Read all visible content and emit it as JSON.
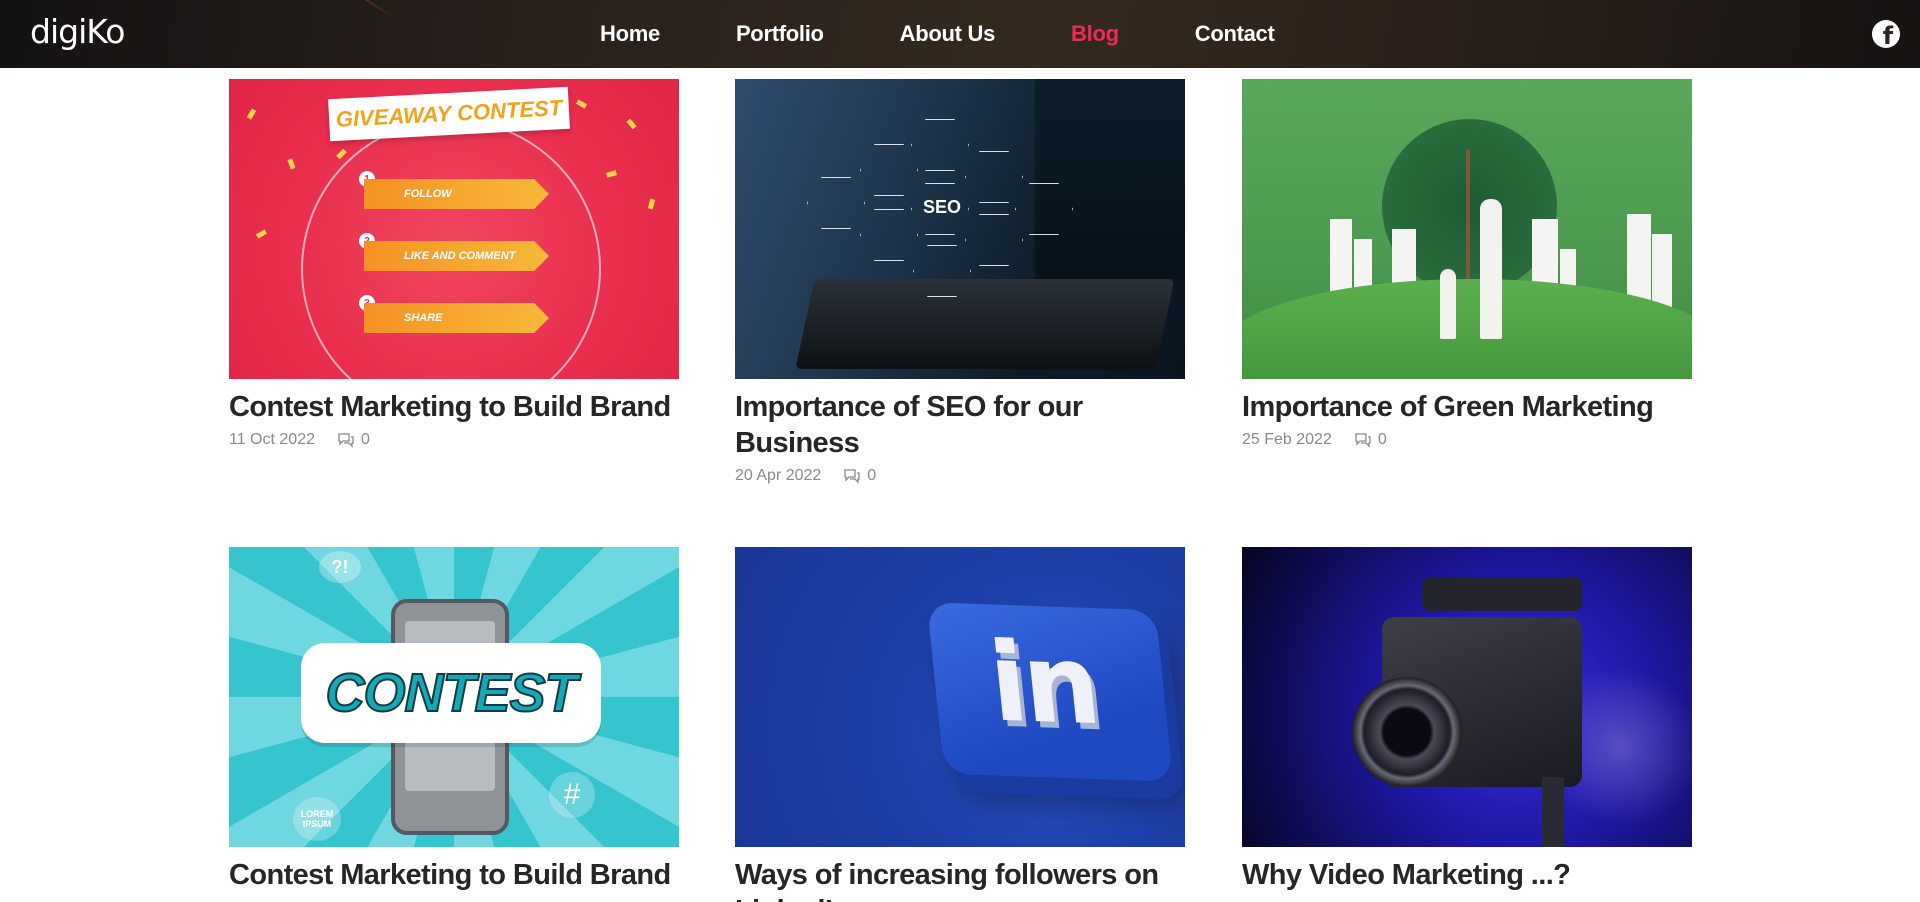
{
  "header": {
    "logo_text": "digiKo",
    "nav": [
      {
        "label": "Home",
        "active": false
      },
      {
        "label": "Portfolio",
        "active": false
      },
      {
        "label": "About Us",
        "active": false
      },
      {
        "label": "Blog",
        "active": true
      },
      {
        "label": "Contact",
        "active": false
      }
    ],
    "social_icon": "facebook-icon",
    "active_color": "#ee2b54"
  },
  "posts": [
    {
      "title": "Contest Marketing to Build Brand",
      "date": "11 Oct 2022",
      "comments": "0",
      "image": {
        "banner": "GIVEAWAY CONTEST",
        "steps": [
          {
            "num": "1",
            "label": "FOLLOW"
          },
          {
            "num": "2",
            "label": "LIKE AND COMMENT"
          },
          {
            "num": "3",
            "label": "SHARE"
          }
        ]
      }
    },
    {
      "title": "Importance of SEO for our Business",
      "date": "20 Apr 2022",
      "comments": "0",
      "image": {
        "hex_label": "SEO"
      }
    },
    {
      "title": "Importance of Green Marketing",
      "date": "25 Feb 2022",
      "comments": "0",
      "image": {}
    },
    {
      "title": "Contest Marketing to Build Brand",
      "image": {
        "word": "CONTEST",
        "badge": "?!",
        "hash": "#",
        "lorem": "LOREM IPSUM"
      }
    },
    {
      "title": "Ways of increasing followers on LinkedIn",
      "image": {
        "word": "in"
      }
    },
    {
      "title": "Why Video Marketing ...?",
      "image": {}
    }
  ]
}
